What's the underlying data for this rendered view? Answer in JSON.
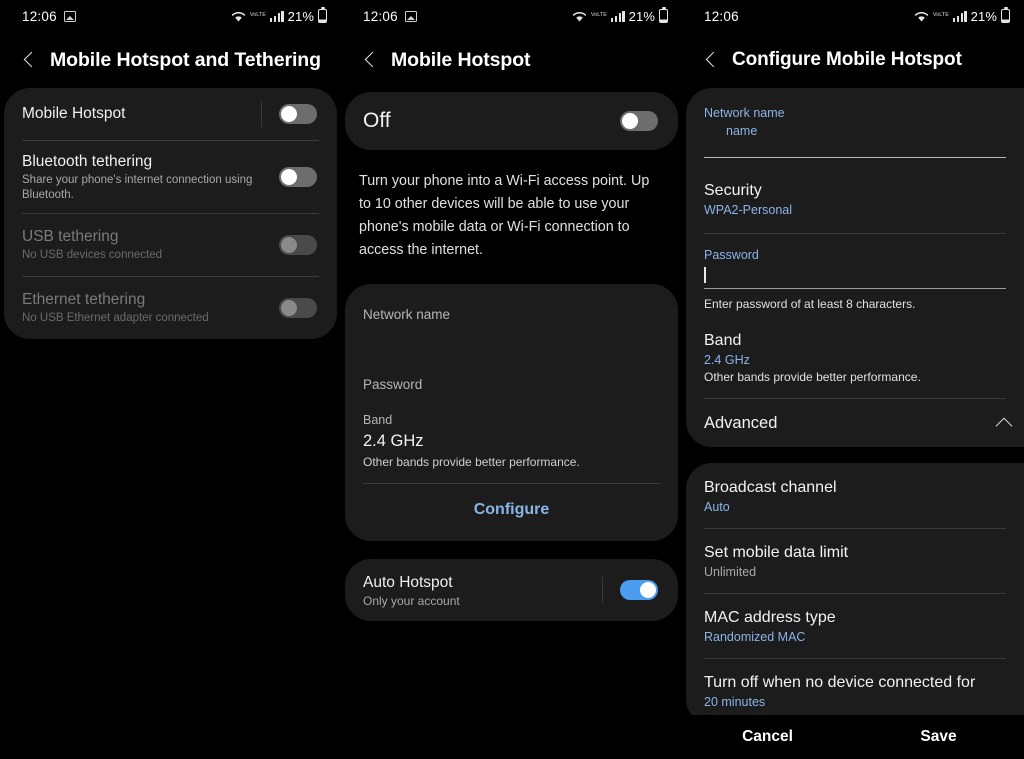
{
  "status_bar": {
    "time": "12:06",
    "battery_percent": "21%",
    "volte_label": "VoLTE",
    "icons": [
      "photo-icon",
      "wifi-icon",
      "volte-icon",
      "signal-bars-icon",
      "battery-icon"
    ]
  },
  "colors": {
    "accent_blue": "#8ab4e8",
    "toggle_on": "#4a9df0",
    "card_bg": "#1c1c1c",
    "screen_bg": "#000000"
  },
  "panel1": {
    "title": "Mobile Hotspot and Tethering",
    "items": [
      {
        "title": "Mobile Hotspot",
        "subtitle": "",
        "toggle": "off",
        "enabled": true
      },
      {
        "title": "Bluetooth tethering",
        "subtitle": "Share your phone's internet connection using Bluetooth.",
        "toggle": "off",
        "enabled": true
      },
      {
        "title": "USB tethering",
        "subtitle": "No USB devices connected",
        "toggle": "off",
        "enabled": false
      },
      {
        "title": "Ethernet tethering",
        "subtitle": "No USB Ethernet adapter connected",
        "toggle": "off",
        "enabled": false
      }
    ]
  },
  "panel2": {
    "title": "Mobile Hotspot",
    "state_label": "Off",
    "state_toggle": "off",
    "description": "Turn your phone into a Wi-Fi access point. Up to 10 other devices will be able to use your phone's mobile data or Wi-Fi connection to access the internet.",
    "network_name_label": "Network name",
    "network_name_value": "",
    "password_label": "Password",
    "password_value": "",
    "band_label": "Band",
    "band_value": "2.4 GHz",
    "band_hint": "Other bands provide better performance.",
    "configure_label": "Configure",
    "auto_hotspot_title": "Auto Hotspot",
    "auto_hotspot_sub": "Only your account",
    "auto_hotspot_toggle": "on"
  },
  "panel3": {
    "title": "Configure Mobile Hotspot",
    "network_name_label": "Network name",
    "network_name_value": "name",
    "security_label": "Security",
    "security_value": "WPA2-Personal",
    "password_label": "Password",
    "password_value": "",
    "password_hint": "Enter password of at least 8 characters.",
    "band_label": "Band",
    "band_value": "2.4 GHz",
    "band_hint": "Other bands provide better performance.",
    "advanced_label": "Advanced",
    "advanced_expanded": true,
    "advanced_items": [
      {
        "title": "Broadcast channel",
        "value": "Auto",
        "value_style": "blue"
      },
      {
        "title": "Set mobile data limit",
        "value": "Unlimited",
        "value_style": "gray"
      },
      {
        "title": "MAC address type",
        "value": "Randomized MAC",
        "value_style": "blue"
      },
      {
        "title": "Turn off when no device connected for",
        "value": "20 minutes",
        "value_style": "blue"
      }
    ],
    "cancel_label": "Cancel",
    "save_label": "Save"
  }
}
